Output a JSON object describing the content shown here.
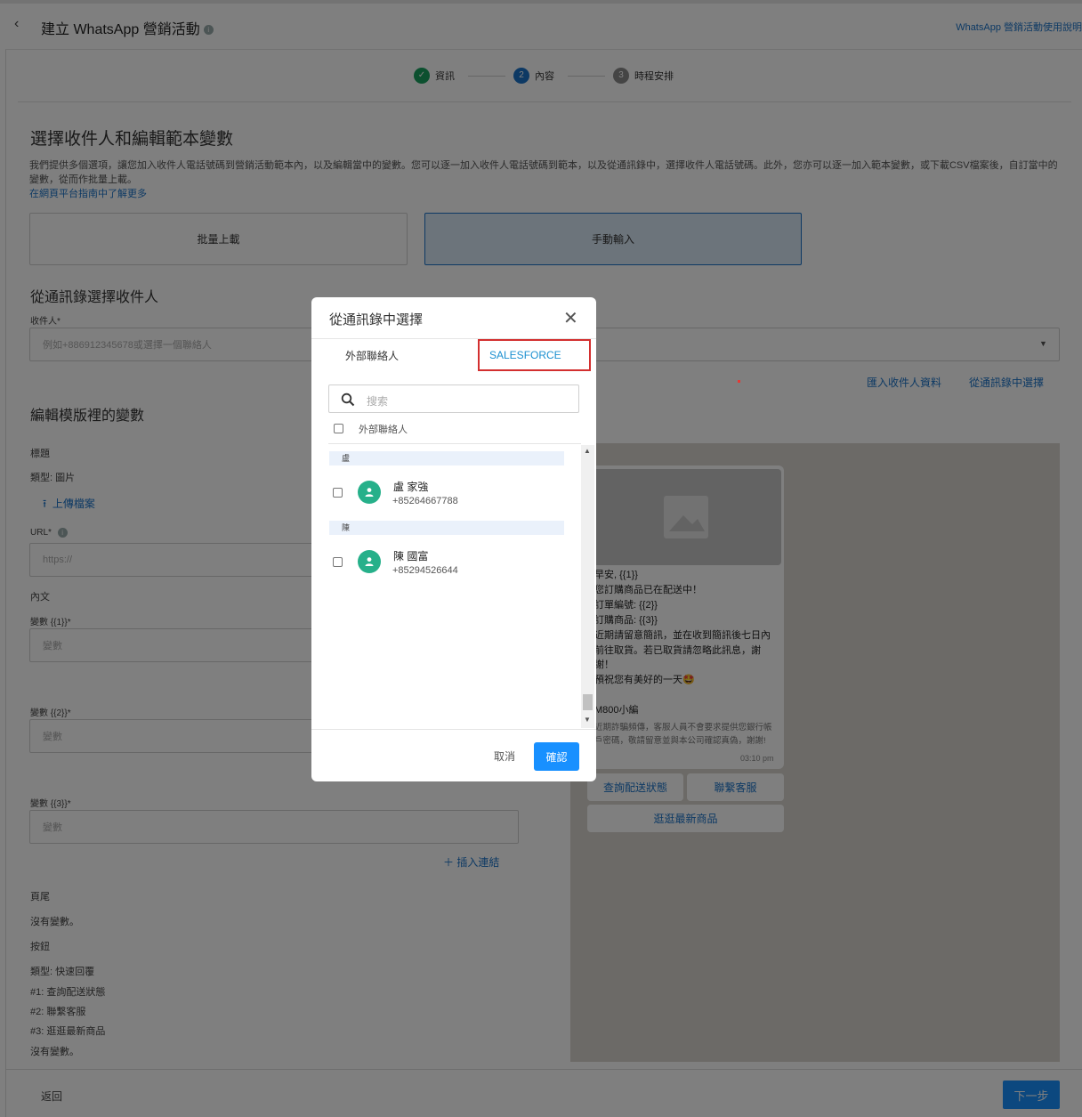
{
  "header": {
    "title": "建立 WhatsApp 營銷活動",
    "help_link": "WhatsApp 營銷活動使用說明"
  },
  "stepper": {
    "steps": [
      {
        "num": "✓",
        "label": "資訊",
        "state": "done"
      },
      {
        "num": "2",
        "label": "內容",
        "state": "current"
      },
      {
        "num": "3",
        "label": "時程安排",
        "state": "pending"
      }
    ]
  },
  "recipients": {
    "heading": "選擇收件人和編輯範本變數",
    "description": "我們提供多個選項，讓您加入收件人電話號碼到營銷活動範本內，以及編輯當中的變數。您可以逐一加入收件人電話號碼到範本，以及從通訊錄中，選擇收件人電話號碼。此外，您亦可以逐一加入範本變數，或下載CSV檔案後，自訂當中的變數，從而作批量上載。",
    "learn_more": "在網頁平台指南中了解更多",
    "bulk_upload": "批量上載",
    "manual_input": "手動輸入",
    "from_contacts_heading": "從通訊錄選擇收件人",
    "recipient_label": "收件人*",
    "recipient_placeholder": "例如+886912345678或選擇一個聯絡人",
    "import_link": "匯入收件人資料",
    "select_from_contacts_link": "從通訊錄中選擇"
  },
  "variables": {
    "heading": "編輯模版裡的變數",
    "header_label": "標題",
    "type_image": "類型: 圖片",
    "upload_file": "上傳檔案",
    "url_label": "URL*",
    "url_placeholder": "https://",
    "body_label": "內文",
    "var1_label": "變數 {{1}}*",
    "var2_label": "變數 {{2}}*",
    "var3_label": "變數 {{3}}*",
    "var_placeholder": "變數",
    "insert_link": "插入連結",
    "footer_label": "頁尾",
    "no_variables": "沒有變數。",
    "buttons_label": "按鈕",
    "buttons_type": "類型: 快速回覆",
    "button1": "#1: 查詢配送狀態",
    "button2": "#2: 聯繫客服",
    "button3": "#3: 逛逛最新商品",
    "no_variables2": "沒有變數。"
  },
  "preview": {
    "message": "早安, {{1}}\n您訂購商品已在配送中！\n訂單編號: {{2}}\n訂購商品: {{3}}\n近期請留意簡訊，並在收到簡訊後七日內前往取貨。若已取貨請忽略此訊息，謝謝！\n預祝您有美好的一天🤩",
    "signature": "M800小編",
    "footer_text": "近期詐騙頻傳，客服人員不會要求提供您銀行帳戶密碼，敬請留意並與本公司確認真偽，謝謝!",
    "time": "03:10 pm",
    "qr1": "查詢配送狀態",
    "qr2": "聯繫客服",
    "qr3": "逛逛最新商品"
  },
  "footer": {
    "back": "返回",
    "next": "下一步"
  },
  "modal": {
    "title": "從通訊錄中選擇",
    "tab_external": "外部聯絡人",
    "tab_salesforce": "SALESFORCE",
    "search_placeholder": "搜索",
    "select_all_label": "外部聯絡人",
    "groups": [
      {
        "letter": "盧",
        "contacts": [
          {
            "name": "盧 家強",
            "phone": "+85264667788"
          }
        ]
      },
      {
        "letter": "陳",
        "contacts": [
          {
            "name": "陳 國富",
            "phone": "+85294526644"
          }
        ]
      }
    ],
    "cancel": "取消",
    "confirm": "確認"
  },
  "colors": {
    "accent": "#1890ff",
    "link": "#1a73c8",
    "success": "#19a15f",
    "highlight_border": "#d32f2f",
    "avatar": "#26b08a"
  }
}
